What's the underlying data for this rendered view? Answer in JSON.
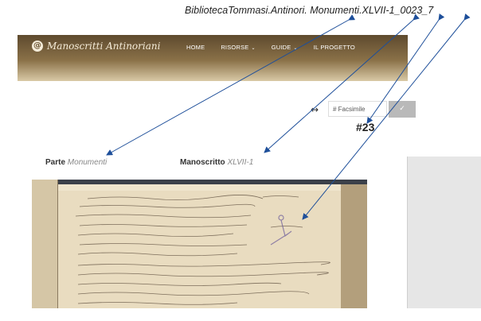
{
  "annotation": {
    "title": "BibliotecaTommasi.Antinori. Monumenti.XLVII-1_0023_7"
  },
  "header": {
    "brand": "Manoscritti Antinoriani",
    "nav": [
      {
        "label": "HOME",
        "dropdown": false
      },
      {
        "label": "RISORSE",
        "dropdown": true
      },
      {
        "label": "GUIDE",
        "dropdown": true
      },
      {
        "label": "IL PROGETTO",
        "dropdown": false
      }
    ]
  },
  "facsimile_search": {
    "placeholder": "# Facsimile",
    "icon_toggle": "↔",
    "submit_icon": "✓"
  },
  "page_marker": "#23",
  "metadata": {
    "parte_label": "Parte",
    "parte_value": "Monumenti",
    "manoscritto_label": "Manoscritto",
    "manoscritto_value": "XLVII-1"
  },
  "colors": {
    "nav_dark": "#5e4a2e",
    "nav_light": "#d9c9a6",
    "arrow": "#1e4f9a"
  },
  "icons": [
    "brand-logo-icon",
    "expand-arrows-icon",
    "check-icon",
    "caret-down-icon"
  ]
}
